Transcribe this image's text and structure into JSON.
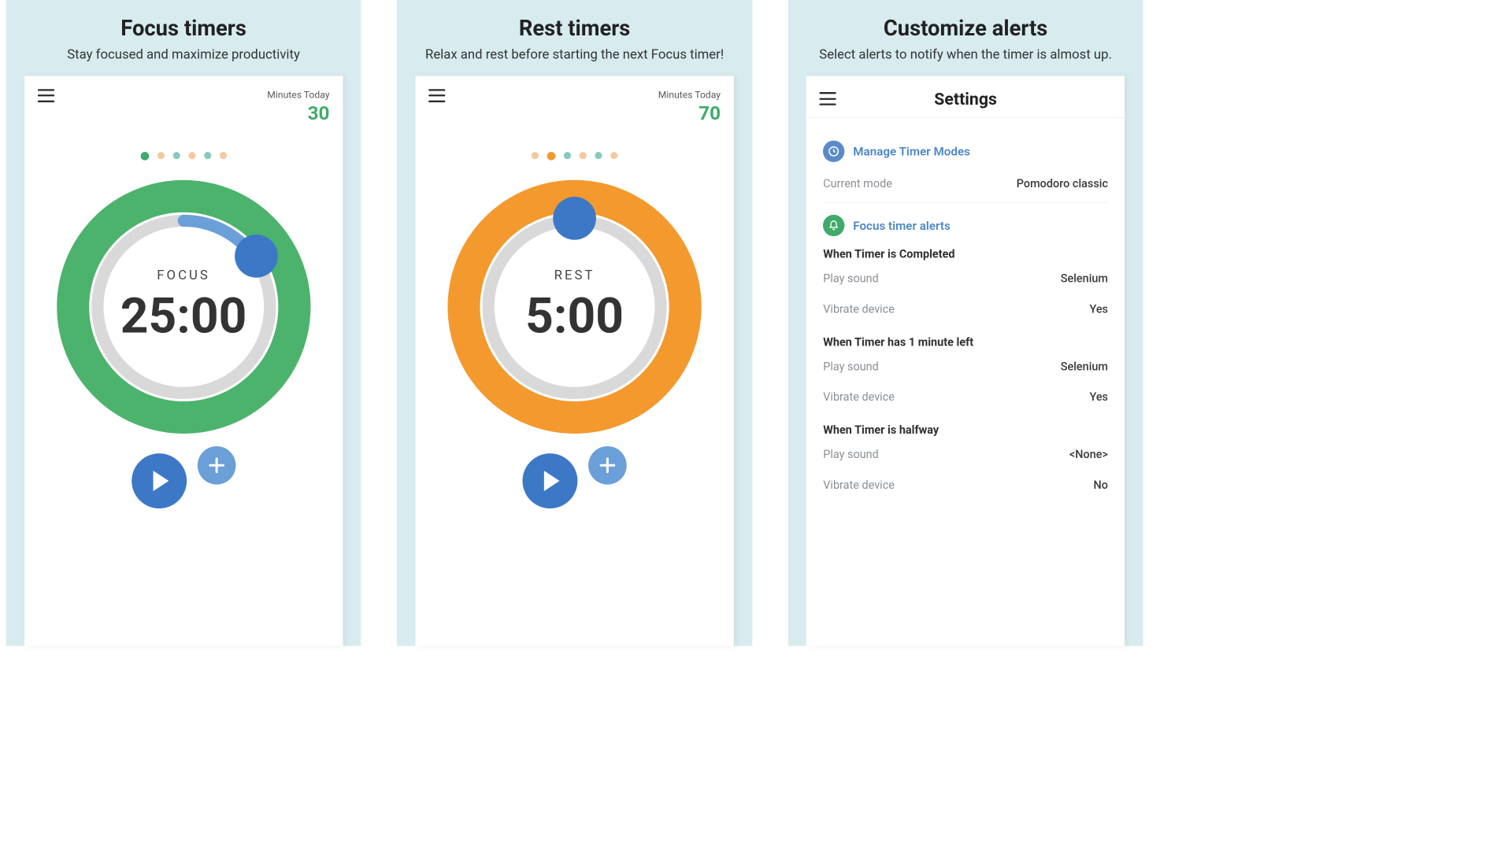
{
  "panels": [
    {
      "title": "Focus timers",
      "subtitle": "Stay focused and maximize productivity",
      "topbar": {
        "minutes_label": "Minutes Today",
        "minutes_value": "30"
      },
      "dots": {
        "active_index": 0,
        "colors": [
          "#3faa6a",
          "#f4c9a2",
          "#89c9b9",
          "#f4c9a2",
          "#89c9b9",
          "#f4c9a2"
        ]
      },
      "timer": {
        "label": "FOCUS",
        "time": "25:00",
        "ring_color": "#4cb36c",
        "progress_color": "#6b9fd8",
        "progress_fraction": 0.18,
        "handle_angle_deg": 55
      }
    },
    {
      "title": "Rest timers",
      "subtitle": "Relax and rest before starting the next Focus timer!",
      "topbar": {
        "minutes_label": "Minutes Today",
        "minutes_value": "70"
      },
      "dots": {
        "active_index": 1,
        "colors": [
          "#f4c9a2",
          "#f4992d",
          "#89c9b9",
          "#f4c9a2",
          "#89c9b9",
          "#f4c9a2"
        ]
      },
      "timer": {
        "label": "REST",
        "time": "5:00",
        "ring_color": "#f4992d",
        "progress_color": "#6b9fd8",
        "progress_fraction": 0.0,
        "handle_angle_deg": 0
      }
    }
  ],
  "settings_panel": {
    "title": "Customize alerts",
    "subtitle": "Select alerts to notify when the timer is almost up.",
    "page_title": "Settings",
    "manage_modes_label": "Manage Timer Modes",
    "current_mode": {
      "k": "Current mode",
      "v": "Pomodoro classic"
    },
    "focus_alerts_label": "Focus timer alerts",
    "groups": [
      {
        "heading": "When Timer is Completed",
        "rows": [
          {
            "k": "Play sound",
            "v": "Selenium"
          },
          {
            "k": "Vibrate device",
            "v": "Yes"
          }
        ]
      },
      {
        "heading": "When Timer has 1 minute left",
        "rows": [
          {
            "k": "Play sound",
            "v": "Selenium"
          },
          {
            "k": "Vibrate device",
            "v": "Yes"
          }
        ]
      },
      {
        "heading": "When Timer is halfway",
        "rows": [
          {
            "k": "Play sound",
            "v": "<None>"
          },
          {
            "k": "Vibrate device",
            "v": "No"
          }
        ]
      }
    ]
  },
  "chart_data": {
    "type": "table",
    "note": "No chart in this screenshot"
  }
}
